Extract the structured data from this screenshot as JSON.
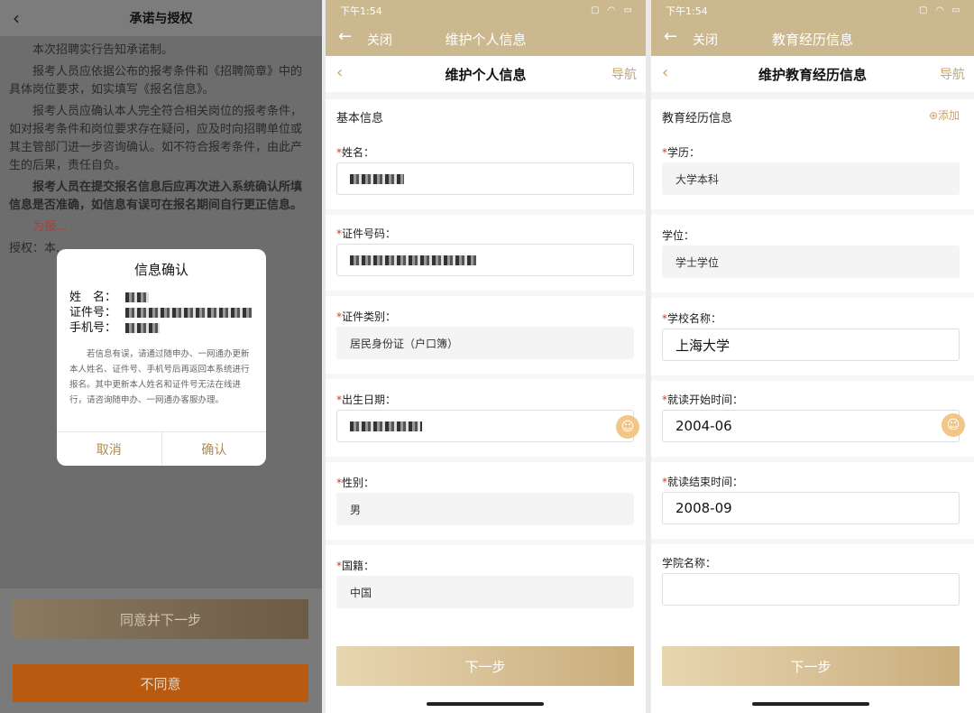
{
  "panel1": {
    "title": "承诺与授权",
    "paragraphs": [
      "本次招聘实行告知承诺制。",
      "报考人员应依据公布的报考条件和《招聘简章》中的具体岗位要求，如实填写《报名信息》。",
      "报考人员应确认本人完全符合相关岗位的报考条件，如对报考条件和岗位要求存在疑问，应及时向招聘单位或其主管部门进一步咨询确认。如不符合报考条件，由此产生的后果，责任自负。",
      "报考人员在提交报名信息后应再次进入系统确认所填信息是否准确，如信息有误可在报名期间自行更正信息。",
      "为报...",
      "授权：本..."
    ],
    "modal": {
      "title": "信息确认",
      "name_label": "姓　名：",
      "id_label": "证件号：",
      "phone_label": "手机号：",
      "note": "若信息有误，请通过随申办、一网通办更新本人姓名、证件号、手机号后再返回本系统进行报名。其中更新本人姓名和证件号无法在线进行，请咨询随申办、一网通办客服办理。",
      "cancel": "取消",
      "confirm": "确认"
    },
    "agree_button": "同意并下一步",
    "disagree_button": "不同意"
  },
  "status_time": "下午1:54",
  "panel2": {
    "close": "关闭",
    "top_title": "维护个人信息",
    "nav_title": "维护个人信息",
    "nav_link": "导航",
    "section": "基本信息",
    "fields": [
      {
        "label": "姓名：",
        "value": ""
      },
      {
        "label": "证件号码：",
        "value": ""
      },
      {
        "label": "证件类别：",
        "value": "居民身份证（户口簿）"
      },
      {
        "label": "出生日期：",
        "value": ""
      },
      {
        "label": "性别：",
        "value": "男"
      },
      {
        "label": "国籍：",
        "value": "中国"
      }
    ],
    "next": "下一步"
  },
  "panel3": {
    "close": "关闭",
    "top_title": "教育经历信息",
    "nav_title": "维护教育经历信息",
    "nav_link": "导航",
    "section": "教育经历信息",
    "add": "⊕添加",
    "fields": [
      {
        "label": "学历：",
        "value": "大学本科"
      },
      {
        "label": "学位：",
        "value": "学士学位"
      },
      {
        "label": "学校名称：",
        "value": "上海大学"
      },
      {
        "label": "就读开始时间：",
        "value": "2004-06"
      },
      {
        "label": "就读结束时间：",
        "value": "2008-09"
      },
      {
        "label": "学院名称：",
        "value": ""
      }
    ],
    "next": "下一步"
  }
}
